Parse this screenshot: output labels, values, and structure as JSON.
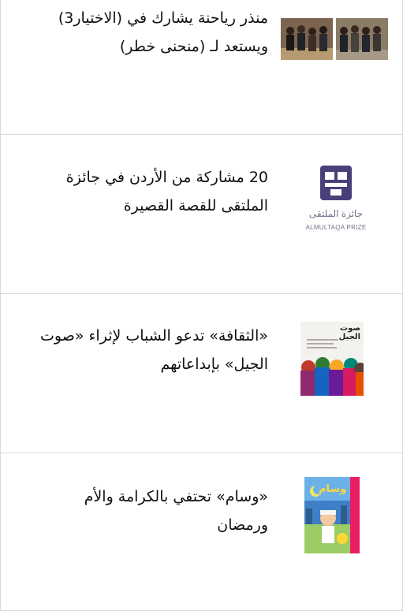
{
  "articles": [
    {
      "title": "منذر رياحنة يشارك في (الاختيار3) ويستعد لـ (منحنى خطر)",
      "thumbnail": "cast-photo-thumbnail"
    },
    {
      "title": "20 مشاركة من الأردن في جائزة الملتقى للقصة القصيرة",
      "thumbnail": "almultaqa-prize-logo",
      "logo_arabic": "جائزة الملتقى",
      "logo_latin": "ALMULTAQA PRIZE"
    },
    {
      "title": "«الثقافة» تدعو الشباب لإثراء «صوت الجيل» بإبداعاتهم",
      "thumbnail": "sawt-aljeel-cover",
      "cover_text": "صوت الجيل"
    },
    {
      "title": "«وسام» تحتفي بالكرامة والأم ورمضان",
      "thumbnail": "wisam-magazine-cover",
      "cover_text": "وسام"
    }
  ],
  "colors": {
    "border": "#d9d9d9",
    "text": "#111111",
    "logo_purple": "#4b3f7a"
  }
}
